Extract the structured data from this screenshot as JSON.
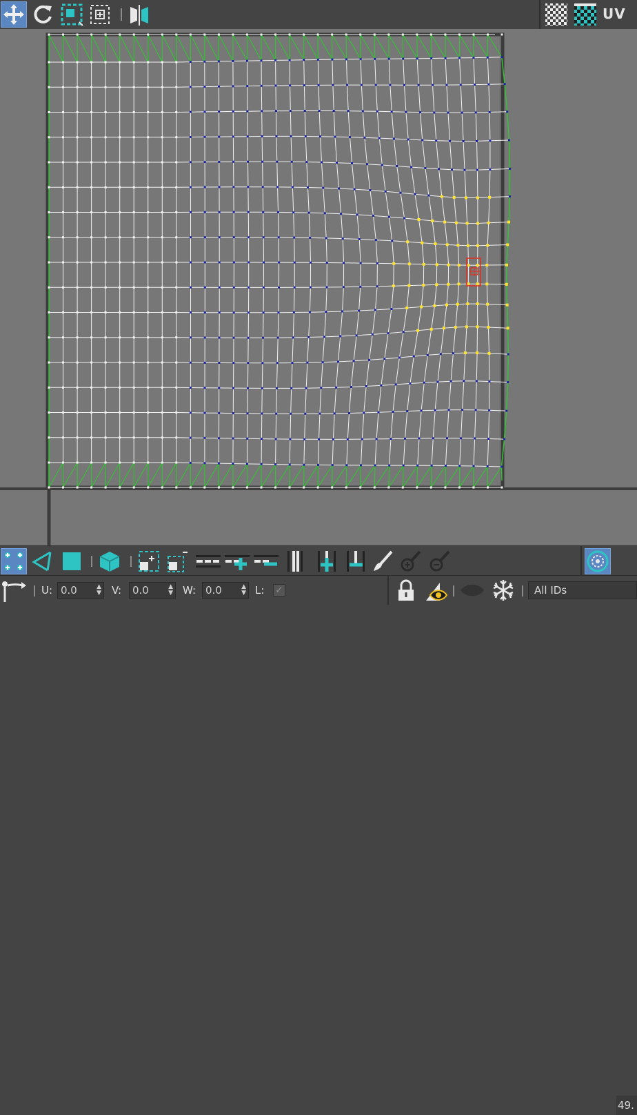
{
  "toolbar": {
    "uv_label": "UV",
    "tools": [
      "move-tool",
      "rotate-tool",
      "scale-tool",
      "freeform-tool",
      "mirror-tool"
    ]
  },
  "uv_editor": {
    "grid_columns": 32,
    "grid_rows": 16,
    "colors": {
      "edge": "#f2f2f2",
      "seam": "#33c233",
      "vertex": "#1a24a0",
      "soft_selection": "#ffe22a",
      "selected": "#e03020",
      "background": "#777777",
      "frame": "#3c3c3c"
    }
  },
  "bottom_toolbar": {
    "value_field": "49.",
    "u_label": "U:",
    "u_value": "0.0",
    "v_label": "V:",
    "v_value": "0.0",
    "w_label": "W:",
    "w_value": "0.0",
    "l_label": "L:",
    "material_ids": "All IDs"
  }
}
